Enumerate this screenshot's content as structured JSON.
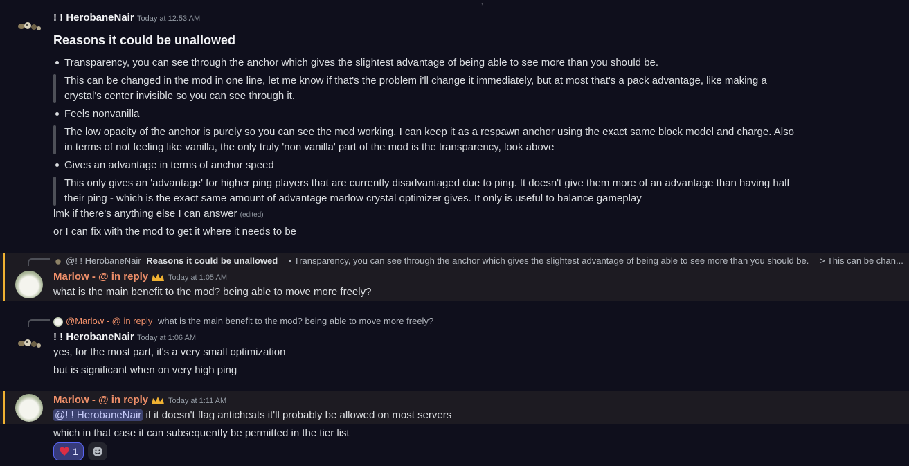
{
  "messages": [
    {
      "author": "! ! HerobaneNair",
      "timestamp": "Today at 12:53 AM",
      "heading": "Reasons it could be unallowed",
      "bullets": [
        {
          "text": "Transparency, you can see through the anchor which gives the slightest advantage of being able to see more than you should be.",
          "quote": [
            "This can be changed in the mod in one line, let me know if that's the problem i'll change it immediately, but at most that's a pack advantage, like making a",
            "crystal's center invisible so you can see through it."
          ]
        },
        {
          "text": "Feels nonvanilla",
          "quote": [
            "The low opacity of the anchor is purely so you can see the mod working. I can keep it as a respawn anchor using the exact same block model and charge. Also",
            "in terms of not feeling like vanilla, the only truly 'non vanilla' part of the mod is the transparency, look above"
          ]
        },
        {
          "text": "Gives an advantage in terms of anchor speed",
          "quote": [
            "This only gives an 'advantage' for higher ping players that are currently disadvantaged due to ping. It doesn't give them more of an advantage than having half",
            "their ping - which is the exact same amount of advantage marlow crystal optimizer gives. It only is useful to balance gameplay"
          ]
        }
      ],
      "after_lines": [
        "lmk if there's anything else I can answer",
        "or I can fix with the mod to get it where it needs to be"
      ],
      "edited_label": "(edited)"
    },
    {
      "reply": {
        "author": "@! ! HerobaneNair",
        "heading": "Reasons it could be unallowed",
        "snippet": "• Transparency, you can see through the anchor which gives the slightest advantage of being able to see more than you should be.",
        "snippet2": "> This can be chan..."
      },
      "author": "Marlow - @ in reply",
      "timestamp": "Today at 1:05 AM",
      "lines": [
        "what is the main benefit to the mod? being able to move more freely?"
      ]
    },
    {
      "reply": {
        "author": "@Marlow - @ in reply",
        "snippet": "what is the main benefit to the mod? being able to move more freely?"
      },
      "author": "! ! HerobaneNair",
      "timestamp": "Today at 1:06 AM",
      "lines": [
        "yes, for the most part, it's a very small optimization",
        "but is significant when on very high ping"
      ]
    },
    {
      "author": "Marlow - @ in reply",
      "timestamp": "Today at 1:11 AM",
      "mention": "@! ! HerobaneNair",
      "mention_rest": " if it doesn't flag anticheats it'll probably be allowed on most servers",
      "lines": [
        "which in that case it can subsequently be permitted in the tier list"
      ],
      "reactions": [
        {
          "emoji": "heart",
          "count": "1"
        }
      ]
    }
  ],
  "colors": {
    "background": "#0f0f1c",
    "mention_highlight": "#1d1b22",
    "mention_bar": "#f0b232",
    "marlow_name": "#f0906a",
    "reaction_active": "#373b7a"
  }
}
